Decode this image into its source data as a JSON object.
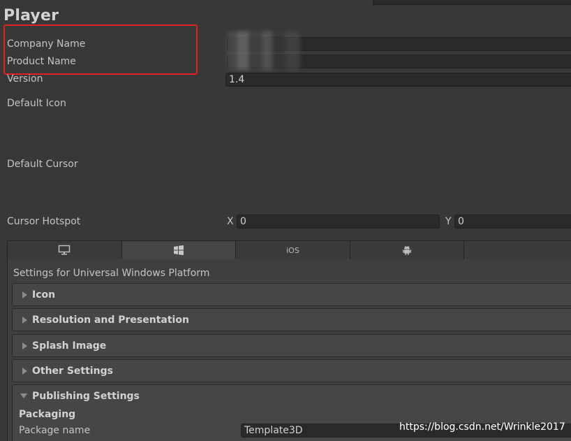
{
  "header": {
    "title": "Player"
  },
  "fields": {
    "company_name_label": "Company Name",
    "product_name_label": "Product Name",
    "version_label": "Version",
    "version_value": "1.4",
    "default_icon_label": "Default Icon",
    "default_cursor_label": "Default Cursor",
    "cursor_hotspot_label": "Cursor Hotspot",
    "hotspot_x_label": "X",
    "hotspot_x_value": "0",
    "hotspot_y_label": "Y",
    "hotspot_y_value": "0"
  },
  "platform_tabs": [
    {
      "icon": "desktop-icon",
      "label": ""
    },
    {
      "icon": "windows-icon",
      "label": "",
      "active": true
    },
    {
      "icon": "",
      "label": "iOS"
    },
    {
      "icon": "android-icon",
      "label": ""
    },
    {
      "icon": "",
      "label": ""
    }
  ],
  "settings": {
    "header": "Settings for Universal Windows Platform",
    "sections": [
      "Icon",
      "Resolution and Presentation",
      "Splash Image",
      "Other Settings",
      "Publishing Settings"
    ],
    "packaging_label": "Packaging",
    "package_name_label": "Package name",
    "package_name_value": "Template3D"
  },
  "watermark": "https://blog.csdn.net/Wrinkle2017",
  "colors": {
    "highlight": "#e02121",
    "background": "#383838"
  }
}
